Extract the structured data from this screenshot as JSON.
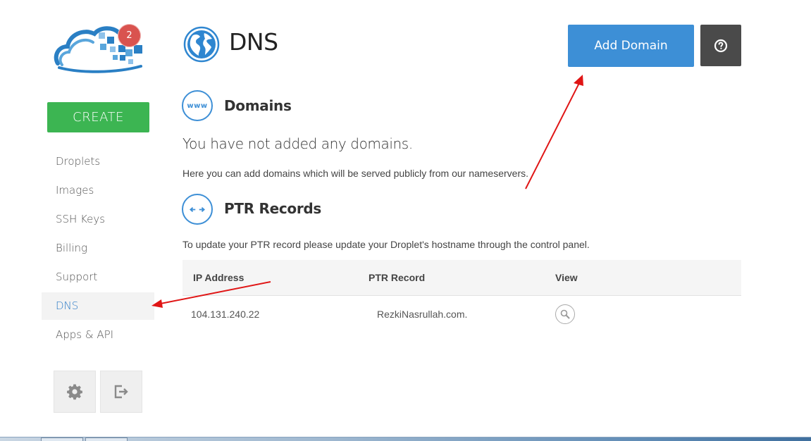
{
  "sidebar": {
    "notification_count": "2",
    "create_label": "CREATE",
    "nav": [
      {
        "label": "Droplets"
      },
      {
        "label": "Images"
      },
      {
        "label": "SSH Keys"
      },
      {
        "label": "Billing"
      },
      {
        "label": "Support"
      },
      {
        "label": "DNS",
        "active": true
      },
      {
        "label": "Apps & API"
      }
    ]
  },
  "header": {
    "title": "DNS",
    "add_domain_label": "Add Domain"
  },
  "domains": {
    "title": "Domains",
    "icon_text": "www",
    "empty_message": "You have not added any domains.",
    "help_text": "Here you can add domains which will be served publicly from our nameservers."
  },
  "ptr": {
    "title": "PTR Records",
    "help_text": "To update your PTR record please update your Droplet's hostname through the control panel.",
    "columns": [
      "IP Address",
      "PTR Record",
      "View"
    ],
    "rows": [
      {
        "ip": "104.131.240.22",
        "record": "RezkiNasrullah.com."
      }
    ]
  },
  "colors": {
    "accent": "#3d8fd6",
    "create": "#3cb552",
    "badge": "#d9534f",
    "annotation_arrow": "#e01515"
  },
  "icons": {
    "page": "globe-icon",
    "help": "question-circle-icon",
    "settings": "gear-icon",
    "logout": "logout-icon",
    "view": "magnifier-icon",
    "ptr": "arrows-in-icon"
  }
}
